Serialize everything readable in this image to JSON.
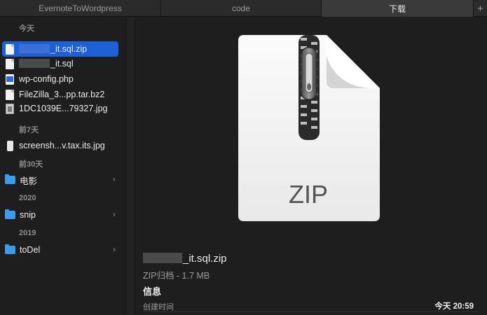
{
  "tabs": [
    "EvernoteToWordpress",
    "code",
    "下载"
  ],
  "tab_add": "+",
  "sections": {
    "today": "今天",
    "week": "前7天",
    "month": "前30天",
    "y2020": "2020",
    "y2019": "2019"
  },
  "files": [
    {
      "name": "_it.sql.zip"
    },
    {
      "name": "_it.sql"
    },
    {
      "name": "wp-config.php"
    },
    {
      "name": "FileZilla_3...pp.tar.bz2"
    },
    {
      "name": "1DC1039E...79327.jpg"
    },
    {
      "name": "screensh...v.tax.its.jpg"
    },
    {
      "name": "电影"
    },
    {
      "name": "snip"
    },
    {
      "name": "toDel"
    }
  ],
  "chevron": "›",
  "preview": {
    "badge": "ZIP",
    "file_name": "_it.sql.zip",
    "kind": "ZIP归档 - 1.7 MB",
    "info_heading": "信息",
    "created_label": "创建时间",
    "created_value": "今天 20:59"
  },
  "colors": {
    "selection": "#1d5fd6",
    "folder": "#3a9bf0",
    "background": "#1e1e1e"
  }
}
